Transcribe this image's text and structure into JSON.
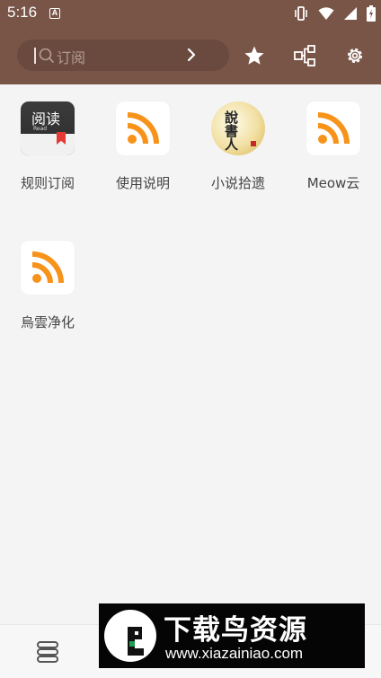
{
  "status_bar": {
    "time": "5:16",
    "notification_letter": "A",
    "icons": [
      "vibrate-icon",
      "wifi-icon",
      "signal-icon",
      "battery-icon"
    ]
  },
  "toolbar": {
    "search_placeholder": "订阅",
    "actions": [
      "star-icon",
      "share-nodes-icon",
      "gear-icon"
    ]
  },
  "sources": [
    {
      "label": "规则订阅",
      "icon": "read-app-icon",
      "tile_main": "阅读",
      "tile_sub": "Read"
    },
    {
      "label": "使用说明",
      "icon": "rss-icon"
    },
    {
      "label": "小说拾遗",
      "icon": "novel-seal-icon",
      "tile_text": "說書人"
    },
    {
      "label": "Meow云",
      "icon": "rss-icon"
    },
    {
      "label": "烏雲净化",
      "icon": "rss-icon"
    }
  ],
  "bottom_nav": {
    "icon": "stack-icon"
  },
  "watermark": {
    "title": "下载鸟资源",
    "url": "www.xiazainiao.com"
  },
  "colors": {
    "primary": "#795548",
    "rss_orange": "#f7931a",
    "background": "#f4f4f4"
  }
}
